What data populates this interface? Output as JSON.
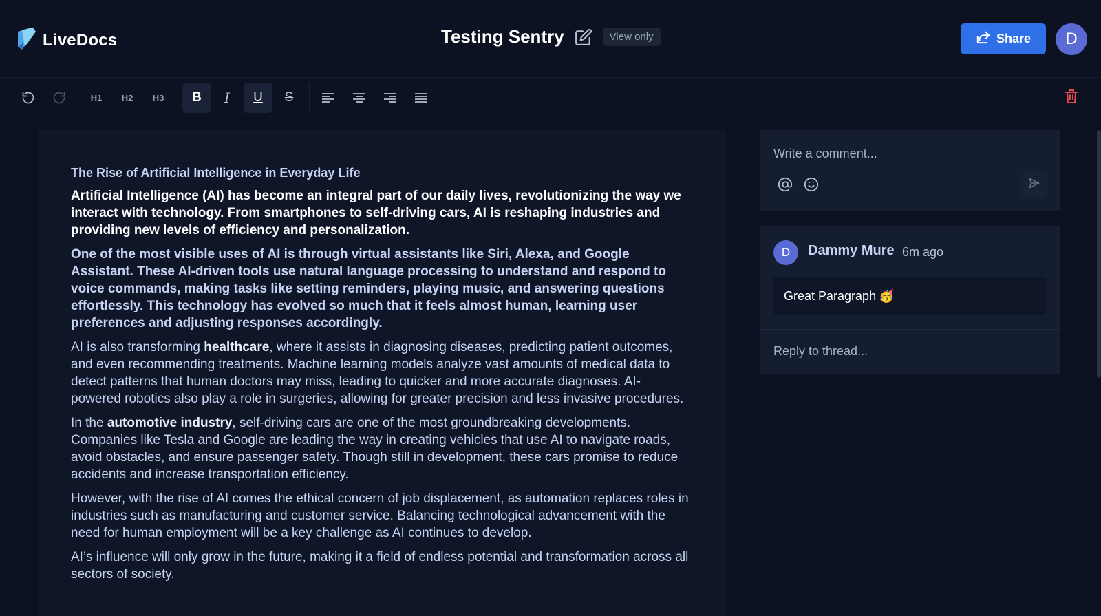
{
  "app": {
    "name": "LiveDocs"
  },
  "document": {
    "title": "Testing Sentry",
    "access_badge": "View only"
  },
  "header": {
    "share_label": "Share",
    "user_initial": "D"
  },
  "toolbar": {
    "items": [
      "undo-icon",
      "redo-icon",
      "H1",
      "H2",
      "H3",
      "bold-icon",
      "italic-icon",
      "underline-icon",
      "strikethrough-icon",
      "align-left-icon",
      "align-center-icon",
      "align-right-icon",
      "align-justify-icon",
      "trash-icon"
    ],
    "h1": "H1",
    "h2": "H2",
    "h3": "H3",
    "active": [
      "bold",
      "underline"
    ],
    "danger_color": "#e5484d"
  },
  "editor": {
    "heading": "The Rise of Artificial Intelligence in Everyday Life",
    "p1": "Artificial Intelligence (AI) has become an integral part of our daily lives, revolutionizing the way we interact with technology. From smartphones to self-driving cars, AI is reshaping industries and providing new levels of efficiency and personalization.",
    "p2": "One of the most visible uses of AI is through virtual assistants like Siri, Alexa, and Google Assistant. These AI-driven tools use natural language processing to understand and respond to voice commands, making tasks like setting reminders, playing music, and answering questions effortlessly. This technology has evolved so much that it feels almost human, learning user preferences and adjusting responses accordingly.",
    "p3_a": "AI is also transforming ",
    "p3_b": "healthcare",
    "p3_c": ", where it assists in diagnosing diseases, predicting patient outcomes, and even recommending treatments. Machine learning models analyze vast amounts of medical data to detect patterns that human doctors may miss, leading to quicker and more accurate diagnoses. AI-powered robotics also play a role in surgeries, allowing for greater precision and less invasive procedures.",
    "p4_a": "In the ",
    "p4_b": "automotive industry",
    "p4_c": ", self-driving cars are one of the most groundbreaking developments. Companies like Tesla and Google are leading the way in creating vehicles that use AI to navigate roads, avoid obstacles, and ensure passenger safety. Though still in development, these cars promise to reduce accidents and increase transportation efficiency.",
    "p5": "However, with the rise of AI comes the ethical concern of job displacement, as automation replaces roles in industries such as manufacturing and customer service. Balancing technological advancement with the need for human employment will be a key challenge as AI continues to develop.",
    "p6": "AI’s influence will only grow in the future, making it a field of endless potential and transformation across all sectors of society."
  },
  "comments": {
    "composer_placeholder": "Write a comment...",
    "thread": {
      "author_initial": "D",
      "author": "Dammy Mure",
      "time": "6m ago",
      "message": "Great Paragraph",
      "emoji": "🥳"
    },
    "reply_placeholder": "Reply to thread..."
  },
  "colors": {
    "accent": "#2f6fe8",
    "avatar": "#5b6bd6",
    "background": "#0b1121"
  }
}
